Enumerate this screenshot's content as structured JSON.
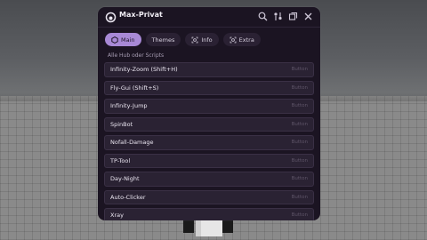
{
  "window": {
    "title": "Max-Privat"
  },
  "titlebar_icons": [
    "search-icon",
    "settings-icon",
    "minimize-icon",
    "close-icon"
  ],
  "tabs": [
    {
      "label": "Main",
      "icon": "circle-icon",
      "active": true
    },
    {
      "label": "Themes",
      "icon": "",
      "active": false
    },
    {
      "label": "Info",
      "icon": "info-icon",
      "active": false
    },
    {
      "label": "Extra",
      "icon": "extra-icon",
      "active": false
    }
  ],
  "section": {
    "label": "Alle Hub oder Scripts"
  },
  "scripts": [
    {
      "label": "Infinity-Zoom (Shift+H)",
      "action": "Button"
    },
    {
      "label": "Fly-Gui (Shift+S)",
      "action": "Button"
    },
    {
      "label": "Infinity-Jump",
      "action": "Button"
    },
    {
      "label": "SpinBot",
      "action": "Button"
    },
    {
      "label": "Nofall-Damage",
      "action": "Button"
    },
    {
      "label": "TP-Tool",
      "action": "Button"
    },
    {
      "label": "Day-Night",
      "action": "Button"
    },
    {
      "label": "Auto-Clicker",
      "action": "Button"
    },
    {
      "label": "Xray",
      "action": "Button"
    }
  ],
  "colors": {
    "panel_bg": "#1b1422",
    "row_bg": "#2a2233",
    "active_tab": "#a889d6",
    "text": "#ebe6f1"
  }
}
